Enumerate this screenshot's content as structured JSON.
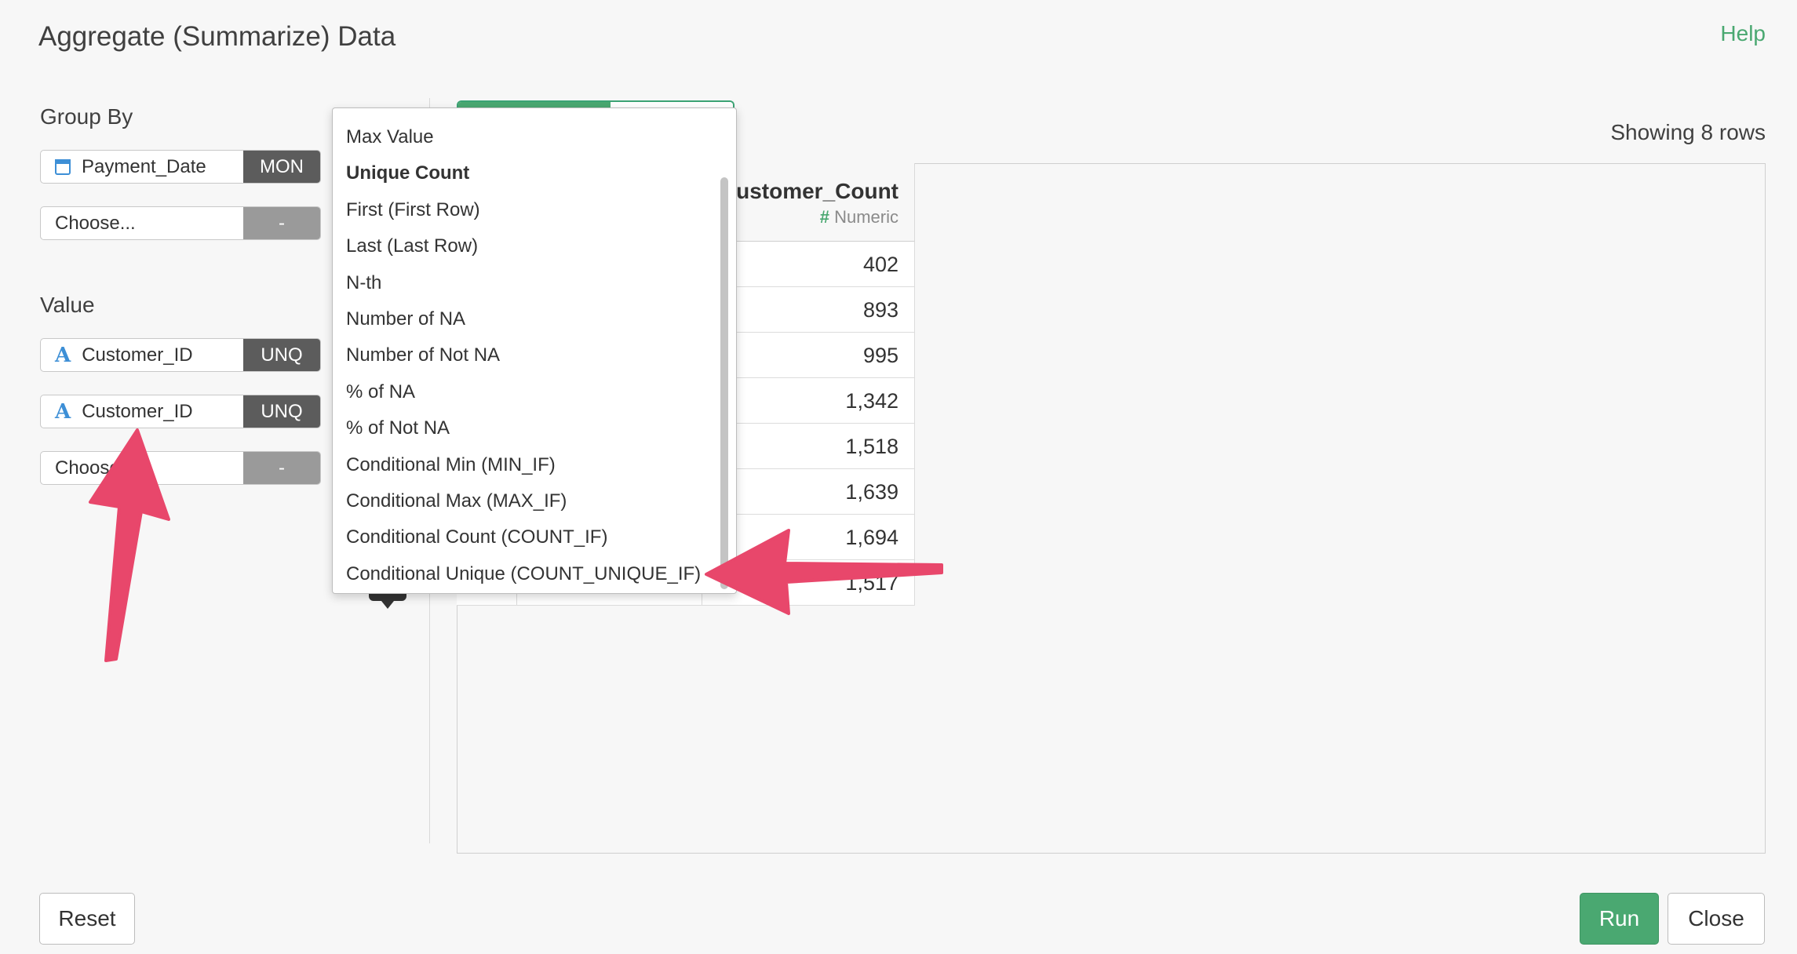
{
  "dialog": {
    "title": "Aggregate (Summarize) Data",
    "help_label": "Help"
  },
  "group_by": {
    "label": "Group By",
    "fields": [
      {
        "name": "Payment_Date",
        "icon": "calendar-icon",
        "badge": "MON"
      },
      {
        "name": "Choose...",
        "icon": "",
        "badge": "-"
      }
    ]
  },
  "value": {
    "label": "Value",
    "fields": [
      {
        "name": "Customer_ID",
        "icon": "text-type-icon",
        "badge": "UNQ"
      },
      {
        "name": "Customer_ID",
        "icon": "text-type-icon",
        "badge": "UNQ"
      },
      {
        "name": "Choose",
        "icon": "",
        "badge": "-"
      }
    ]
  },
  "preview": {
    "showing": "Showing 8 rows",
    "column": {
      "title": "ustomer_Count",
      "type": "Numeric",
      "type_icon": "#"
    },
    "rows": [
      "402",
      "893",
      "995",
      "1,342",
      "1,518",
      "1,639",
      "1,694",
      "1,517"
    ]
  },
  "dropdown": {
    "items": [
      "Max Value",
      "Unique Count",
      "First (First Row)",
      "Last (Last Row)",
      "N-th",
      "Number of NA",
      "Number of Not NA",
      "% of NA",
      "% of Not NA",
      "Conditional Min (MIN_IF)",
      "Conditional Max (MAX_IF)",
      "Conditional Count (COUNT_IF)",
      "Conditional Unique (COUNT_UNIQUE_IF)"
    ],
    "selected_index": 1
  },
  "buttons": {
    "reset": "Reset",
    "run": "Run",
    "close": "Close"
  },
  "colors": {
    "accent": "#4aa871",
    "annotation_arrow": "#e8476b",
    "badge_dark": "#5c5c5c"
  }
}
